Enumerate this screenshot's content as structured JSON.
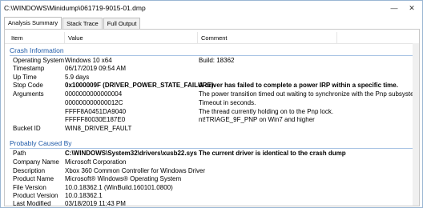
{
  "window": {
    "title": "C:\\WINDOWS\\Minidump\\061719-9015-01.dmp",
    "minimize": "—",
    "close": "✕"
  },
  "tabs": [
    "Analysis Summary",
    "Stack Trace",
    "Full Output"
  ],
  "columns": [
    "Item",
    "Value",
    "Comment"
  ],
  "groups": {
    "crash": "Crash Information",
    "caused": "Probably Caused By"
  },
  "crash_rows": [
    {
      "item": "Operating System",
      "value": "Windows 10 x64",
      "comment": "Build: 18362"
    },
    {
      "item": "Timestamp",
      "value": "06/17/2019 09:54 AM",
      "comment": ""
    },
    {
      "item": "Up Time",
      "value": "5.9 days",
      "comment": ""
    },
    {
      "item": "Stop Code",
      "value": "0x1000009F (DRIVER_POWER_STATE_FAILURE)",
      "comment": "A driver has failed to complete a power IRP within a specific time."
    },
    {
      "item": "Arguments",
      "value": "0000000000000004",
      "comment": "The power transition timed out waiting to synchronize with the Pnp subsystem."
    },
    {
      "item": "",
      "value": "000000000000012C",
      "comment": "Timeout in seconds."
    },
    {
      "item": "",
      "value": "FFFF8A0451DA9040",
      "comment": "The thread currently holding on to the Pnp lock."
    },
    {
      "item": "",
      "value": "FFFFF80030E187E0",
      "comment": "nt!TRIAGE_9F_PNP on Win7 and higher"
    },
    {
      "item": "Bucket ID",
      "value": "WIN8_DRIVER_FAULT",
      "comment": ""
    }
  ],
  "caused_rows": [
    {
      "item": "Path",
      "value": "C:\\WINDOWS\\System32\\drivers\\xusb22.sys",
      "comment": "The current driver is identical to the crash dump"
    },
    {
      "item": "Company Name",
      "value": "Microsoft Corporation",
      "comment": ""
    },
    {
      "item": "Description",
      "value": "Xbox 360 Common Controller for Windows Driver",
      "comment": ""
    },
    {
      "item": "Product Name",
      "value": "Microsoft® Windows® Operating System",
      "comment": ""
    },
    {
      "item": "File Version",
      "value": "10.0.18362.1 (WinBuild.160101.0800)",
      "comment": ""
    },
    {
      "item": "Product Version",
      "value": "10.0.18362.1",
      "comment": ""
    },
    {
      "item": "Last Modified",
      "value": "03/18/2019 11:43 PM",
      "comment": ""
    }
  ]
}
